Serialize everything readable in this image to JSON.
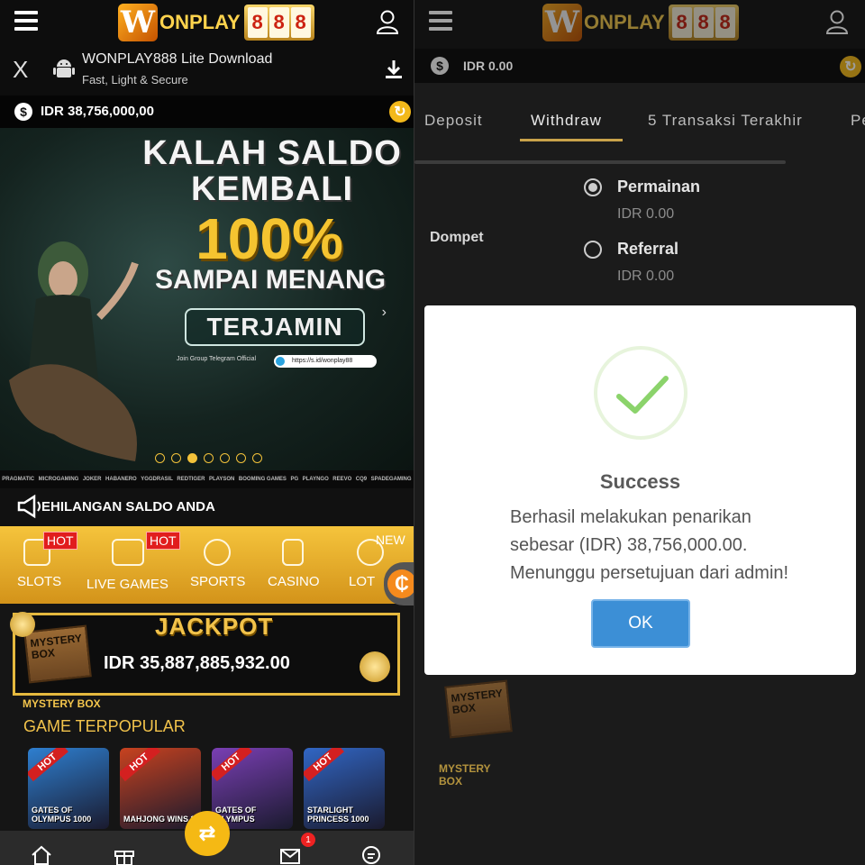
{
  "left": {
    "logo": {
      "brand": "ONPLAY",
      "slot": [
        "8",
        "8",
        "8"
      ]
    },
    "download": {
      "close": "X",
      "title": "WONPLAY888 Lite Download",
      "subtitle": "Fast, Light & Secure"
    },
    "balance": {
      "currency_symbol": "$",
      "amount": "IDR 38,756,000,00"
    },
    "banner": {
      "line1": "KALAH SALDO KEMBALI",
      "line2": "100%",
      "line3": "SAMPAI MENANG",
      "line4": "TERJAMIN",
      "telegram_label": "Join Group Telegram Official",
      "telegram_link": "https://s.id/wonplay88",
      "next": "›",
      "slides": 7,
      "active_slide": 3
    },
    "providers": [
      "PRAGMATIC",
      "MICROGAMING",
      "JOKER",
      "HABANERO",
      "YGGDRASIL",
      "REDTIGER",
      "PLAYSON",
      "BOOMING GAMES",
      "PG",
      "PLAYNGO",
      "REEVO",
      "CQ9",
      "SPADEGAMING"
    ],
    "marquee": "EHILANGAN SALDO ANDA",
    "categories": [
      {
        "label": "SLOTS",
        "badge": "HOT"
      },
      {
        "label": "LIVE GAMES",
        "badge": "HOT"
      },
      {
        "label": "SPORTS",
        "badge": ""
      },
      {
        "label": "CASINO",
        "badge": ""
      },
      {
        "label": "LOT",
        "badge": "NEW"
      }
    ],
    "jackpot": {
      "title": "JACKPOT",
      "amount": "IDR 35,887,885,932.00",
      "mystery_label": "MYSTERY BOX",
      "mbox_text": "MYSTERY BOX"
    },
    "popular": {
      "title": "GAME TERPOPULAR",
      "hot_label": "HOT",
      "games": [
        {
          "name": "GATES OF OLYMPUS 1000",
          "color": "#2e7fd0"
        },
        {
          "name": "MAHJONG WINS 3",
          "color": "#c8421f"
        },
        {
          "name": "GATES OF OLYMPUS",
          "color": "#7a3fb4"
        },
        {
          "name": "STARLIGHT PRINCESS 1000",
          "color": "#3166c4"
        }
      ]
    },
    "nav": {
      "mail_count": "1",
      "swap_symbol": "⇄"
    }
  },
  "right": {
    "logo": {
      "brand": "ONPLAY",
      "slot": [
        "8",
        "8",
        "8"
      ]
    },
    "balance": {
      "currency_symbol": "$",
      "amount": "IDR 0.00"
    },
    "tabs": [
      "Deposit",
      "Withdraw",
      "5 Transaksi Terakhir",
      "Pe"
    ],
    "active_tab": "Withdraw",
    "wallet_label": "Dompet",
    "options": [
      {
        "label": "Permainan",
        "amount": "IDR 0.00",
        "checked": true
      },
      {
        "label": "Referral",
        "amount": "IDR 0.00",
        "checked": false
      }
    ],
    "modal": {
      "title": "Success",
      "line1": "Berhasil melakukan penarikan",
      "line2": "sebesar (IDR) 38,756,000.00.",
      "line3": "Menunggu persetujuan dari admin!",
      "ok": "OK"
    },
    "mystery_label": "MYSTERY BOX",
    "mbox_text": "MYSTERY BOX"
  },
  "colors": {
    "accent_gold": "#f3c23a",
    "ok_blue": "#3c8fd6",
    "check_green": "#8bd36b",
    "hot_red": "#e11d1d"
  }
}
